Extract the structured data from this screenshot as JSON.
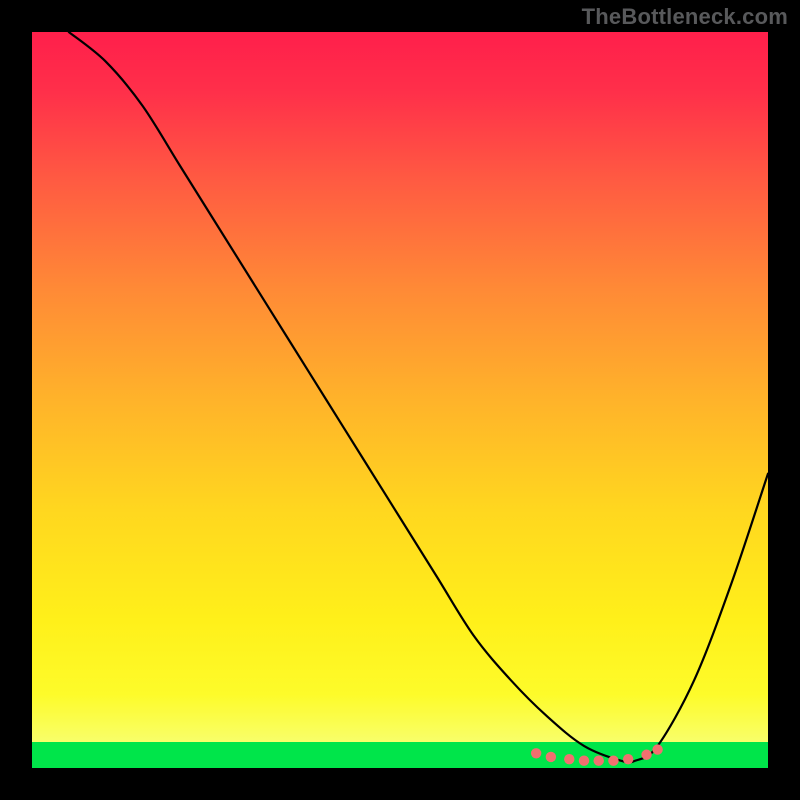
{
  "watermark": "TheBottleneck.com",
  "chart_data": {
    "type": "line",
    "title": "",
    "xlabel": "",
    "ylabel": "",
    "xlim": [
      0,
      100
    ],
    "ylim": [
      0,
      100
    ],
    "grid": false,
    "legend": false,
    "series": [
      {
        "name": "curve",
        "color": "#000000",
        "x": [
          5,
          10,
          15,
          20,
          25,
          30,
          35,
          40,
          45,
          50,
          55,
          60,
          65,
          70,
          75,
          80,
          82,
          85,
          90,
          95,
          100
        ],
        "y": [
          100,
          96,
          90,
          82,
          74,
          66,
          58,
          50,
          42,
          34,
          26,
          18,
          12,
          7,
          3,
          1,
          1,
          3,
          12,
          25,
          40
        ]
      },
      {
        "name": "green-band",
        "type": "area",
        "color": "#00e54a",
        "y_range": [
          0,
          3.5
        ]
      },
      {
        "name": "dots",
        "type": "scatter",
        "color": "#f26f6f",
        "points": [
          {
            "x": 68.5,
            "y": 2.0
          },
          {
            "x": 70.5,
            "y": 1.5
          },
          {
            "x": 73.0,
            "y": 1.2
          },
          {
            "x": 75.0,
            "y": 1.0
          },
          {
            "x": 77.0,
            "y": 1.0
          },
          {
            "x": 79.0,
            "y": 1.0
          },
          {
            "x": 81.0,
            "y": 1.2
          },
          {
            "x": 83.5,
            "y": 1.8
          },
          {
            "x": 85.0,
            "y": 2.5
          }
        ]
      }
    ],
    "gradient_stops": [
      {
        "offset": 0.0,
        "color": "#ff1f4b"
      },
      {
        "offset": 0.08,
        "color": "#ff2f4a"
      },
      {
        "offset": 0.2,
        "color": "#ff5a42"
      },
      {
        "offset": 0.35,
        "color": "#ff8a36"
      },
      {
        "offset": 0.5,
        "color": "#ffb32a"
      },
      {
        "offset": 0.65,
        "color": "#ffd71f"
      },
      {
        "offset": 0.8,
        "color": "#fff01a"
      },
      {
        "offset": 0.9,
        "color": "#fdfb2a"
      },
      {
        "offset": 0.965,
        "color": "#f8ff6a"
      },
      {
        "offset": 0.965,
        "color": "#00e54a"
      },
      {
        "offset": 1.0,
        "color": "#00e54a"
      }
    ]
  }
}
